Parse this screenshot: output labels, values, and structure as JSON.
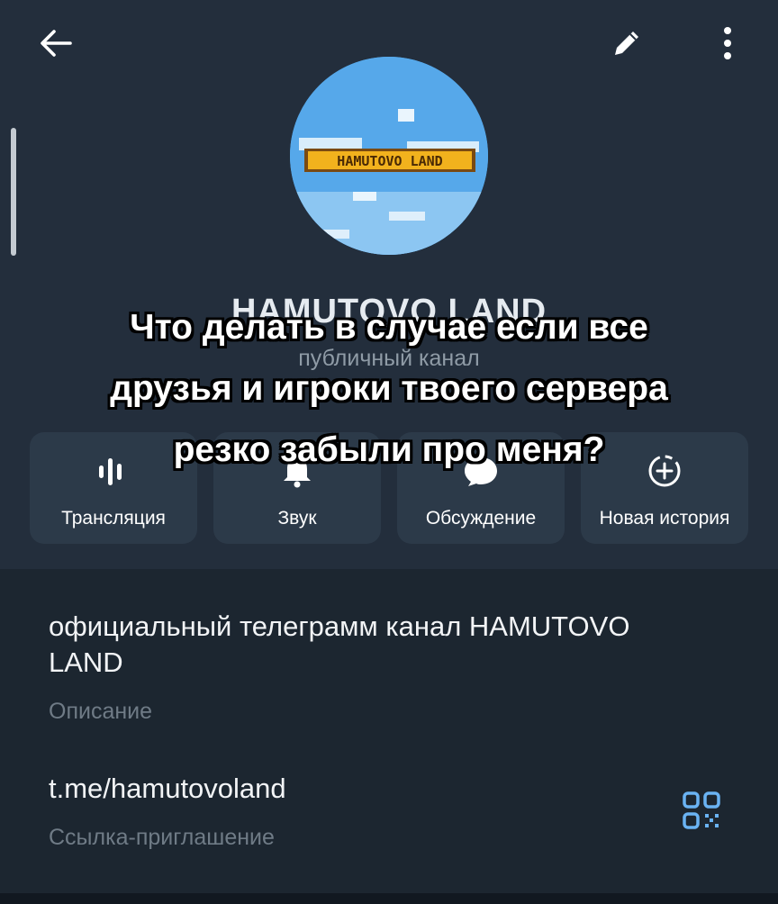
{
  "header": {
    "back_icon": "arrow-left-icon",
    "edit_icon": "pencil-icon",
    "more_icon": "vertical-dots-icon"
  },
  "channel": {
    "avatar_text": "HAMUTOVO LAND",
    "name": "HAMUTOVO LAND",
    "subtitle": "публичный канал"
  },
  "actions": [
    {
      "label": "Трансляция",
      "icon": "live-stream-icon"
    },
    {
      "label": "Звук",
      "icon": "bell-icon"
    },
    {
      "label": "Обсуждение",
      "icon": "chat-bubble-icon"
    },
    {
      "label": "Новая история",
      "icon": "add-story-icon"
    }
  ],
  "info": {
    "description": "официальный телеграмм канал HAMUTOVO LAND",
    "description_caption": "Описание",
    "link": "t.me/hamutovoland",
    "link_caption": "Ссылка-приглашение",
    "qr_icon": "qr-code-icon"
  },
  "overlay": {
    "caption": "Что делать в случае если все\nдрузья и игроки твоего сервера\nрезко забыли про меня?"
  },
  "colors": {
    "header_bg": "#232e3c",
    "page_bg": "#1c2630",
    "button_bg": "#2c3a49",
    "avatar_sky": "#56a8ea",
    "accent": "#6ab3f3"
  }
}
